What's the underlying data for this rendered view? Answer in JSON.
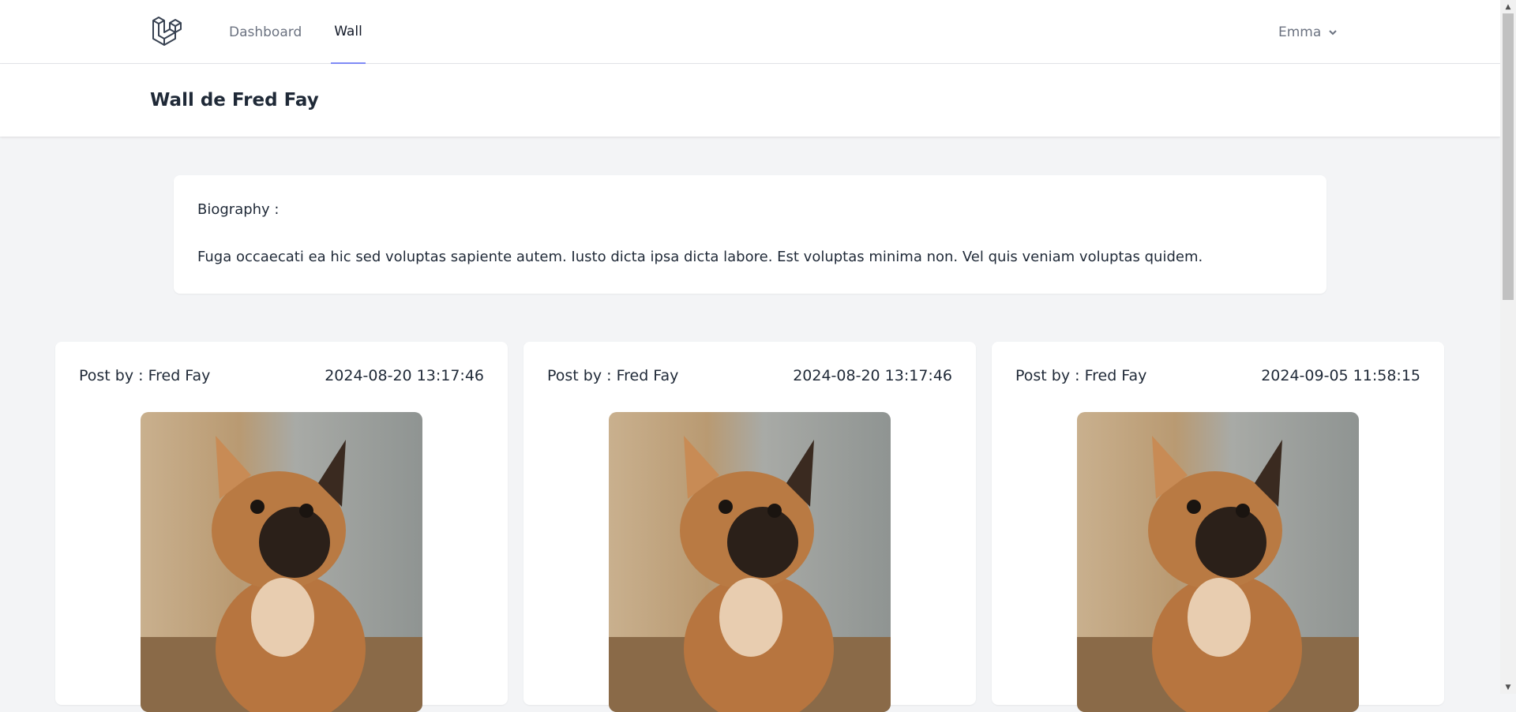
{
  "nav": {
    "logo_icon": "laravel-logo-icon",
    "links": [
      {
        "label": "Dashboard",
        "active": false
      },
      {
        "label": "Wall",
        "active": true
      }
    ],
    "user": {
      "name": "Emma",
      "icon": "chevron-down-icon"
    }
  },
  "header": {
    "title": "Wall de Fred Fay"
  },
  "biography": {
    "label": "Biography :",
    "text": "Fuga occaecati ea hic sed voluptas sapiente autem. Iusto dicta ipsa dicta labore. Est voluptas minima non. Vel quis veniam voluptas quidem."
  },
  "posts": [
    {
      "author_label": "Post by : Fred Fay",
      "date": "2024-08-20 13:17:46",
      "image": "french-bulldog-photo"
    },
    {
      "author_label": "Post by : Fred Fay",
      "date": "2024-08-20 13:17:46",
      "image": "french-bulldog-photo"
    },
    {
      "author_label": "Post by : Fred Fay",
      "date": "2024-09-05 11:58:15",
      "image": "french-bulldog-photo"
    }
  ],
  "colors": {
    "accent": "#818cf8",
    "page_bg": "#f3f4f6",
    "card_bg": "#ffffff"
  }
}
